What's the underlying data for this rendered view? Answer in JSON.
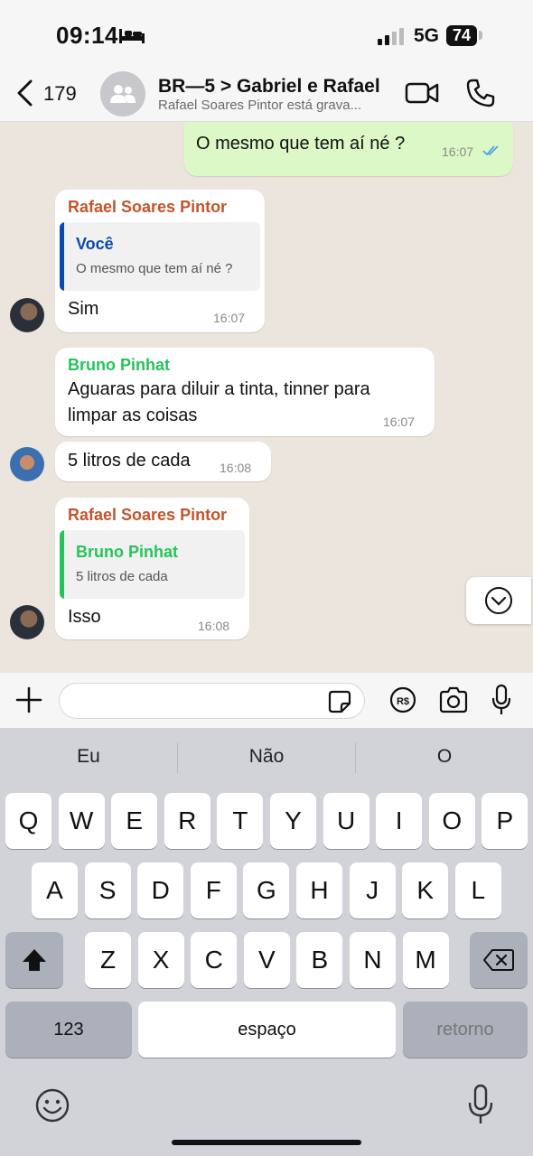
{
  "status_bar": {
    "time": "09:14",
    "network": "5G",
    "battery": "74"
  },
  "header": {
    "back_count": "179",
    "title": "BR—5 > Gabriel e Rafael",
    "subtitle": "Rafael Soares Pintor está grava..."
  },
  "messages": [
    {
      "type": "outgoing",
      "text": "O mesmo que tem aí né ?",
      "time": "16:07"
    },
    {
      "type": "incoming",
      "sender": "Rafael Soares Pintor",
      "quote_name": "Você",
      "quote_text": "O mesmo que tem aí né ?",
      "text": "Sim",
      "time": "16:07"
    },
    {
      "type": "incoming",
      "sender": "Bruno Pinhat",
      "text_line1": "Aguaras para diluir a tinta, tinner para",
      "text_line2": "limpar as coisas",
      "time": "16:07"
    },
    {
      "type": "incoming",
      "text": "5 litros de cada",
      "time": "16:08"
    },
    {
      "type": "incoming",
      "sender": "Rafael Soares Pintor",
      "quote_name": "Bruno Pinhat",
      "quote_text": "5 litros de cada",
      "text": "Isso",
      "time": "16:08"
    }
  ],
  "colors": {
    "rafael": "#c5532c",
    "bruno": "#25c35a",
    "voce": "#0b4aa8",
    "check": "#4fa3e8"
  },
  "keyboard": {
    "suggestions": [
      "Eu",
      "Não",
      "O"
    ],
    "row1": [
      "Q",
      "W",
      "E",
      "R",
      "T",
      "Y",
      "U",
      "I",
      "O",
      "P"
    ],
    "row2": [
      "A",
      "S",
      "D",
      "F",
      "G",
      "H",
      "J",
      "K",
      "L"
    ],
    "row3": [
      "Z",
      "X",
      "C",
      "V",
      "B",
      "N",
      "M"
    ],
    "numbers": "123",
    "space": "espaço",
    "return": "retorno"
  }
}
